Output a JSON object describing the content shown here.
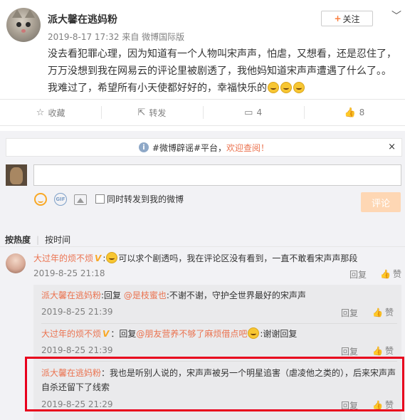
{
  "post": {
    "username": "派大馨在逃妈粉",
    "meta": "2019-8-17 17:32 来自 微博国际版",
    "follow_label": "关注",
    "text": "没去看犯罪心理，因为知道有一个人物叫宋声声，怕虐，又想看，还是忍住了，万万没想到我在网易云的评论里被剧透了，我他妈知道宋声声遭遇了什么了。。我难过了，希望所有小天使都好好的，幸福快乐的",
    "emoji_count": 3
  },
  "actions": {
    "collect": "收藏",
    "repost": "转发",
    "comment": "4",
    "like": "8"
  },
  "notice": {
    "text": "#微博辟谣#平台，",
    "link": "欢迎查阅！",
    "close": "×"
  },
  "composer": {
    "placeholder": "",
    "repost_checkbox_label": "同时转发到我的微博",
    "submit_label": "评论"
  },
  "sort": {
    "hot": "按热度",
    "time": "按时间"
  },
  "comments": [
    {
      "name": "大过年的烦不烦",
      "text": "可以求个剧透吗，我在评论区没有看到，一直不敢看宋声声那段",
      "date": "2019-8-25 21:18",
      "reply": "回复",
      "like": "赞"
    }
  ],
  "replies": [
    {
      "name": "派大馨在逃妈粉",
      "prefix": ":回复 ",
      "at": "@是枝蜜也",
      "text": ":不谢不谢，守护全世界最好的宋声声",
      "date": "2019-8-25 21:39",
      "reply": "回复",
      "like": "赞"
    },
    {
      "name": "大过年的烦不烦",
      "prefix": "：回复",
      "at": "@朋友营养不够了麻烦借点吧",
      "text": ":谢谢回复",
      "date": "2019-8-25 21:39",
      "reply": "回复",
      "like": "赞"
    },
    {
      "name": "派大馨在逃妈粉",
      "prefix": "",
      "at": "",
      "text": "：我也是听别人说的，宋声声被另一个明星追害（虐凌他之类的），后来宋声声自杀还留下了线索",
      "date": "2019-8-25 21:29",
      "reply": "回复",
      "like": "赞"
    }
  ],
  "colors": {
    "accent": "#eb7350",
    "highlight_border": "#e8001c",
    "submit_bg": "#fed7b4"
  }
}
